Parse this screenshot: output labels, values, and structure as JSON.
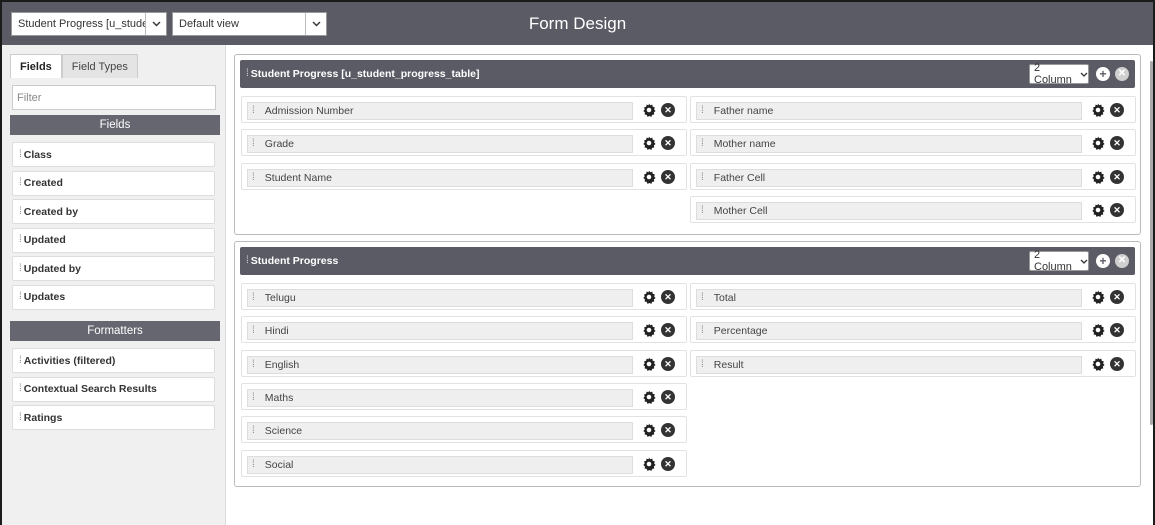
{
  "topbar": {
    "table_select": "Student Progress [u_studei",
    "view_select": "Default view",
    "title": "Form Design"
  },
  "left": {
    "tabs": [
      "Fields",
      "Field Types"
    ],
    "filter_placeholder": "Filter",
    "fields_header": "Fields",
    "fields": [
      "Class",
      "Created",
      "Created by",
      "Updated",
      "Updated by",
      "Updates"
    ],
    "formatters_header": "Formatters",
    "formatters": [
      "Activities (filtered)",
      "Contextual Search Results",
      "Ratings"
    ]
  },
  "sections": [
    {
      "title": "Student Progress  [u_student_progress_table]",
      "columns": "2 Column",
      "left_fields": [
        "Admission Number",
        "Grade",
        "Student Name"
      ],
      "right_fields": [
        "Father name",
        "Mother name",
        "Father Cell",
        "Mother Cell"
      ]
    },
    {
      "title": "Student Progress",
      "columns": "2 Column",
      "left_fields": [
        "Telugu",
        "Hindi",
        "English",
        "Maths",
        "Science",
        "Social"
      ],
      "right_fields": [
        "Total",
        "Percentage",
        "Result"
      ]
    }
  ],
  "icons": {
    "grip": "⁞",
    "gear": "✿",
    "remove": "✕",
    "add": "+",
    "chevron": "⌄"
  }
}
